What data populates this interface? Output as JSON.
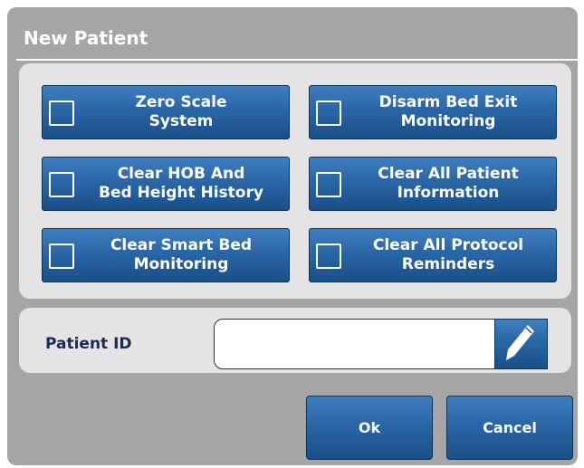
{
  "dialog": {
    "title": "New Patient",
    "options": [
      {
        "label": "Zero Scale\nSystem",
        "checked": false
      },
      {
        "label": "Disarm Bed Exit\nMonitoring",
        "checked": false
      },
      {
        "label": "Clear HOB And\nBed Height History",
        "checked": false
      },
      {
        "label": "Clear All Patient\nInformation",
        "checked": false
      },
      {
        "label": "Clear Smart Bed\nMonitoring",
        "checked": false
      },
      {
        "label": "Clear All Protocol\nReminders",
        "checked": false
      }
    ],
    "patient_id": {
      "label": "Patient ID",
      "value": "",
      "edit_icon": "pencil-icon"
    },
    "ok_label": "Ok",
    "cancel_label": "Cancel"
  },
  "colors": {
    "panel_gray": "#a5a5a5",
    "inner_panel": "#e4e4e4",
    "button_blue": "#2a66a6",
    "label_navy": "#1b2c54"
  }
}
